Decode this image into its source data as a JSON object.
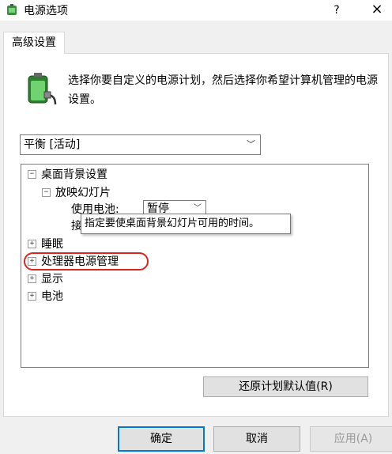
{
  "window": {
    "title": "电源选项",
    "help": "?",
    "close": "×"
  },
  "tab": {
    "label": "高级设置"
  },
  "description": "选择你要自定义的电源计划，然后选择你希望计算机管理的电源设置。",
  "plan_select": {
    "value": "平衡 [活动]"
  },
  "tree": {
    "desktop_background": {
      "expander": "⊟",
      "label": "桌面背景设置"
    },
    "slideshow": {
      "expander": "⊟",
      "label": "放映幻灯片"
    },
    "battery_setting": {
      "label": "使用电池:",
      "value": "暂停"
    },
    "plugged_setting": {
      "label": "接"
    },
    "sleep": {
      "expander": "⊞",
      "label": "睡眠"
    },
    "processor": {
      "expander": "⊞",
      "label": "处理器电源管理"
    },
    "display": {
      "expander": "⊞",
      "label": "显示"
    },
    "battery": {
      "expander": "⊞",
      "label": "电池"
    }
  },
  "tooltip": "指定要使桌面背景幻灯片可用的时间。",
  "restore_button": "还原计划默认值(R)",
  "buttons": {
    "ok": "确定",
    "cancel": "取消",
    "apply": "应用(A)"
  },
  "colors": {
    "highlight": "#d9261c",
    "default_button_border": "#0078d7"
  }
}
